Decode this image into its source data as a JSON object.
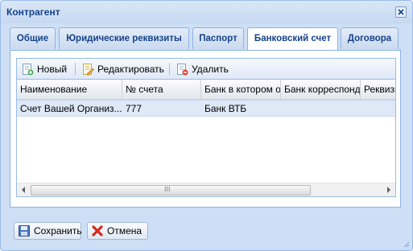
{
  "window": {
    "title": "Контрагент"
  },
  "tabs": [
    {
      "label": "Общие"
    },
    {
      "label": "Юридические реквизиты"
    },
    {
      "label": "Паспорт"
    },
    {
      "label": "Банковский счет",
      "active": true
    },
    {
      "label": "Договора"
    }
  ],
  "toolbar": {
    "new_label": "Новый",
    "edit_label": "Редактировать",
    "delete_label": "Удалить"
  },
  "grid": {
    "columns": [
      "Наименование",
      "№ счета",
      "Банк в котором от",
      "Банк корреспонде",
      "Реквизи"
    ],
    "rows": [
      [
        "Счет Вашей Организ...",
        "777",
        "Банк ВТБ",
        "",
        ""
      ]
    ],
    "scroll_grip": "III"
  },
  "footer": {
    "save_label": "Сохранить",
    "cancel_label": "Отмена"
  },
  "icons": [
    "close-icon",
    "new-document-icon",
    "edit-document-icon",
    "delete-document-icon",
    "save-disk-icon",
    "cancel-x-icon"
  ]
}
